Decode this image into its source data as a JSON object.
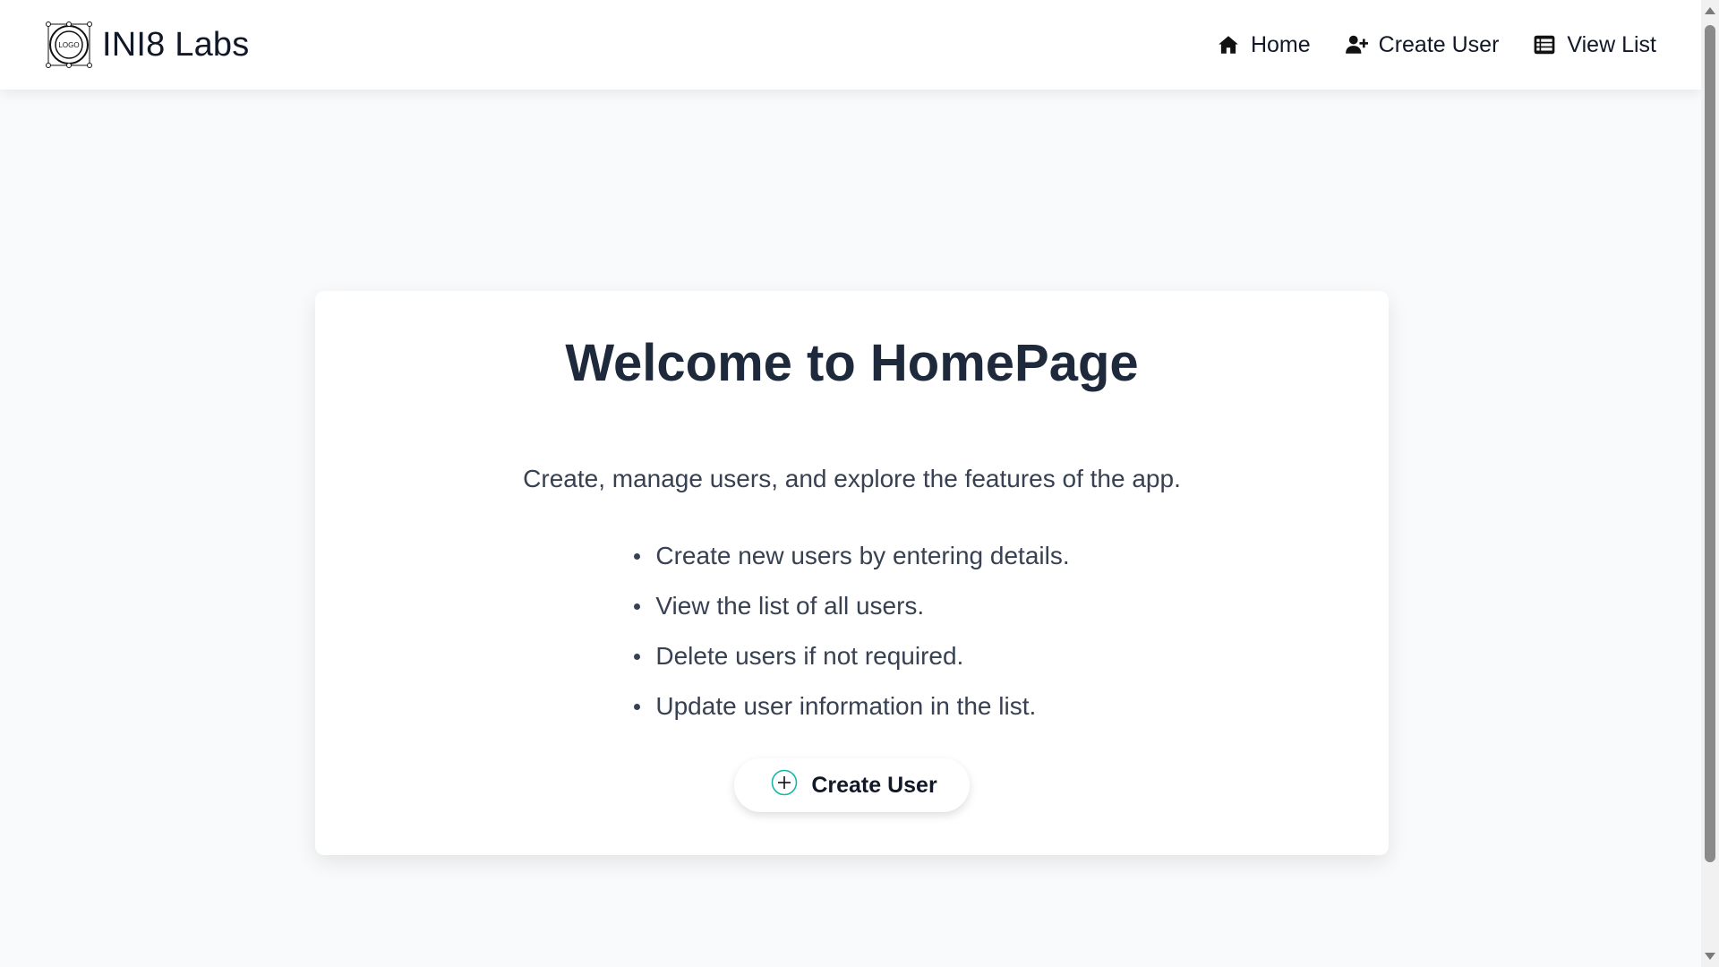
{
  "navbar": {
    "brand_name": "INI8 Labs",
    "logo_text": "LOGO",
    "links": [
      {
        "label": "Home",
        "icon": "home-icon"
      },
      {
        "label": "Create User",
        "icon": "user-plus-icon"
      },
      {
        "label": "View List",
        "icon": "list-icon"
      }
    ]
  },
  "main": {
    "title": "Welcome to HomePage",
    "description": "Create, manage users, and explore the features of the app.",
    "features": [
      "Create new users by entering details.",
      "View the list of all users.",
      "Delete users if not required.",
      "Update user information in the list."
    ],
    "cta_label": "Create User",
    "cta_icon": "plus-circle-icon"
  },
  "colors": {
    "background": "#f9fafb",
    "title": "#1e293b",
    "body_text": "#374151",
    "accent_icon": "#14b8a6"
  }
}
